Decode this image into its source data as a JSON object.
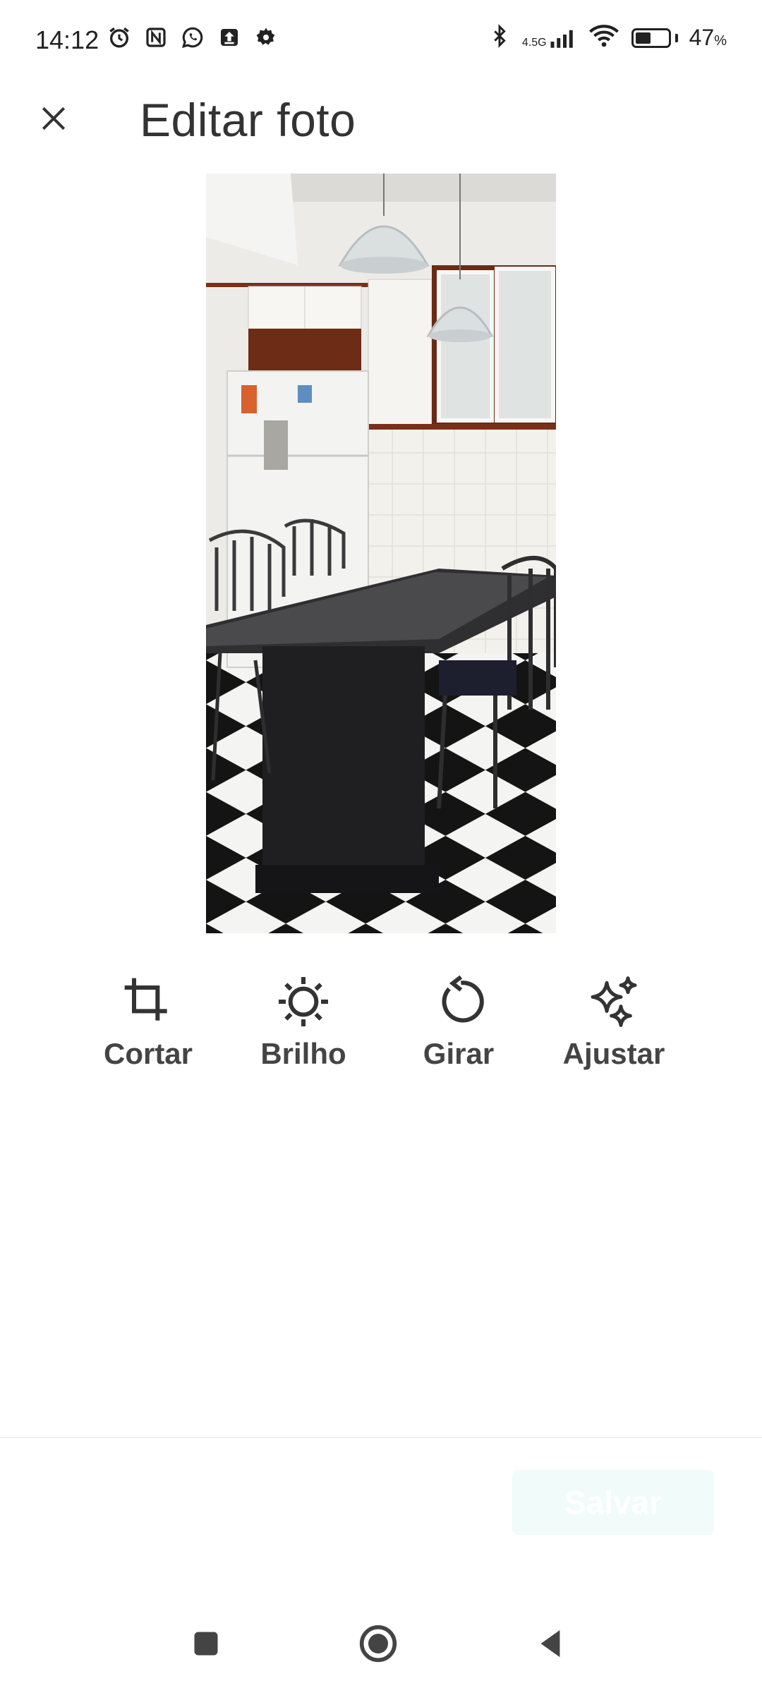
{
  "status_bar": {
    "time": "14:12",
    "network": "4.5G",
    "battery_percent": "47",
    "battery_unit": "%",
    "battery_level": 0.47,
    "icons": [
      "alarm-icon",
      "nfc-icon",
      "whatsapp-icon",
      "upload-icon",
      "settings-gear-icon",
      "bluetooth-icon",
      "signal-icon",
      "wifi-icon",
      "battery-icon"
    ]
  },
  "header": {
    "title": "Editar foto",
    "close_icon": "close-icon"
  },
  "photo": {
    "subject": "kitchen-table-photo"
  },
  "tools": [
    {
      "label": "Cortar",
      "icon": "crop-icon"
    },
    {
      "label": "Brilho",
      "icon": "brightness-icon"
    },
    {
      "label": "Girar",
      "icon": "rotate-icon"
    },
    {
      "label": "Ajustar",
      "icon": "sparkle-icon"
    }
  ],
  "actions": {
    "save_label": "Salvar",
    "save_enabled": false
  },
  "colors": {
    "accent_disabled": "#f1fbf9",
    "text": "#222222"
  },
  "nav": {
    "icons": [
      "recents-square-icon",
      "home-circle-icon",
      "back-triangle-icon"
    ]
  }
}
